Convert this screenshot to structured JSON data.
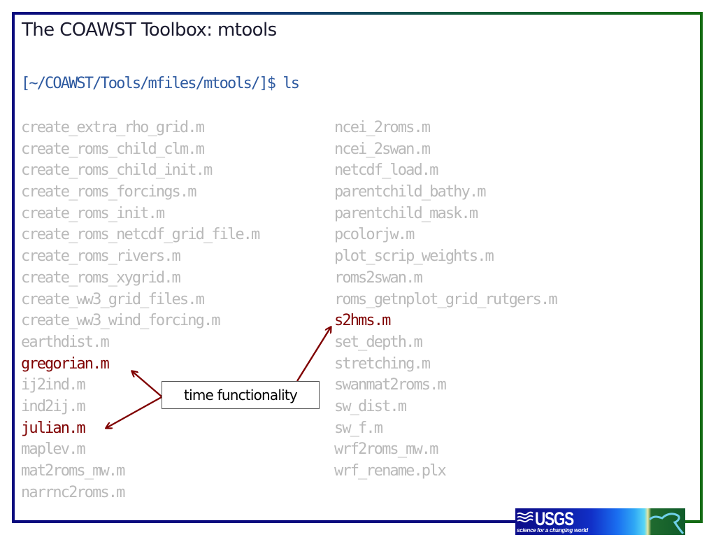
{
  "slide": {
    "title": "The COAWST Toolbox: mtools",
    "prompt": "[~/COAWST/Tools/mfiles/mtools/]$ ls"
  },
  "listing": {
    "left_column": [
      {
        "name": "create_extra_rho_grid.m",
        "highlighted": false
      },
      {
        "name": "create_roms_child_clm.m",
        "highlighted": false
      },
      {
        "name": "create_roms_child_init.m",
        "highlighted": false
      },
      {
        "name": "create_roms_forcings.m",
        "highlighted": false
      },
      {
        "name": "create_roms_init.m",
        "highlighted": false
      },
      {
        "name": "create_roms_netcdf_grid_file.m",
        "highlighted": false
      },
      {
        "name": "create_roms_rivers.m",
        "highlighted": false
      },
      {
        "name": "create_roms_xygrid.m",
        "highlighted": false
      },
      {
        "name": "create_ww3_grid_files.m",
        "highlighted": false
      },
      {
        "name": "create_ww3_wind_forcing.m",
        "highlighted": false
      },
      {
        "name": "earthdist.m",
        "highlighted": false
      },
      {
        "name": "gregorian.m",
        "highlighted": true
      },
      {
        "name": "ij2ind.m",
        "highlighted": false
      },
      {
        "name": "ind2ij.m",
        "highlighted": false
      },
      {
        "name": "julian.m",
        "highlighted": true
      },
      {
        "name": "maplev.m",
        "highlighted": false
      },
      {
        "name": "mat2roms_mw.m",
        "highlighted": false
      },
      {
        "name": "narrnc2roms.m",
        "highlighted": false
      }
    ],
    "right_column": [
      {
        "name": "ncei_2roms.m",
        "highlighted": false
      },
      {
        "name": "ncei_2swan.m",
        "highlighted": false
      },
      {
        "name": "netcdf_load.m",
        "highlighted": false
      },
      {
        "name": "parentchild_bathy.m",
        "highlighted": false
      },
      {
        "name": "parentchild_mask.m",
        "highlighted": false
      },
      {
        "name": "pcolorjw.m",
        "highlighted": false
      },
      {
        "name": "plot_scrip_weights.m",
        "highlighted": false
      },
      {
        "name": "roms2swan.m",
        "highlighted": false
      },
      {
        "name": "roms_getnplot_grid_rutgers.m",
        "highlighted": false
      },
      {
        "name": "s2hms.m",
        "highlighted": true
      },
      {
        "name": "set_depth.m",
        "highlighted": false
      },
      {
        "name": "stretching.m",
        "highlighted": false
      },
      {
        "name": "swanmat2roms.m",
        "highlighted": false
      },
      {
        "name": "sw_dist.m",
        "highlighted": false
      },
      {
        "name": "sw_f.m",
        "highlighted": false
      },
      {
        "name": "wrf2roms_mw.m",
        "highlighted": false
      },
      {
        "name": "wrf_rename.plx",
        "highlighted": false
      }
    ]
  },
  "callout": {
    "label": "time functionality",
    "points_to": [
      "gregorian.m",
      "julian.m",
      "s2hms.m"
    ]
  },
  "logo": {
    "name": "USGS",
    "tagline": "science for a changing world"
  },
  "colors": {
    "highlight": "#7f0000",
    "muted_text": "#b9b9b9",
    "prompt": "#2e5aa0",
    "frame_navy": "#0a0a7e",
    "frame_green": "#136b12",
    "arrow": "#7f0000"
  }
}
